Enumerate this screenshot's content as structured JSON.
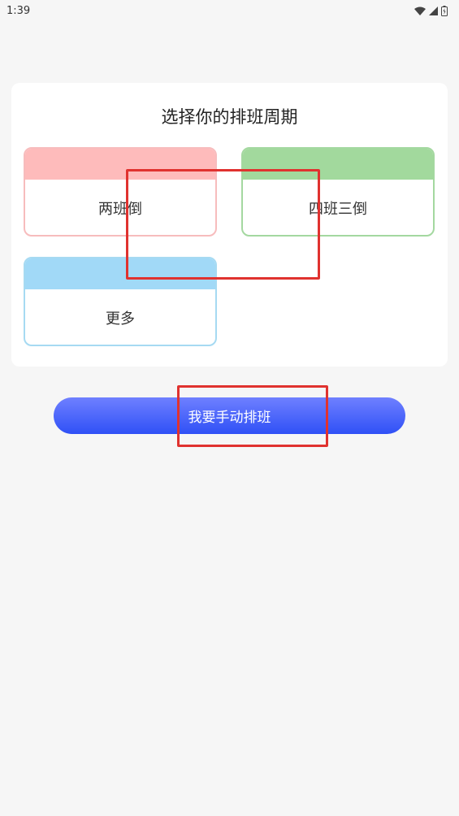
{
  "status_bar": {
    "time": "1:39",
    "icons": [
      "wifi-icon",
      "signal-icon",
      "battery-icon"
    ]
  },
  "card": {
    "title": "选择你的排班周期",
    "options": [
      {
        "label": "两班倒",
        "color": "#febbbb",
        "border": "#f7bcbd"
      },
      {
        "label": "四班三倒",
        "color": "#a2d99d",
        "border": "#a4d8a0"
      },
      {
        "label": "更多",
        "color": "#a1d9f7",
        "border": "#a6daf2"
      }
    ]
  },
  "manual_button": {
    "label": "我要手动排班",
    "gradient": [
      "#6f80ff",
      "#2f50f6"
    ]
  },
  "colors": {
    "background": "#f6f6f6",
    "card": "#ffffff",
    "highlight": "#e0322f"
  }
}
